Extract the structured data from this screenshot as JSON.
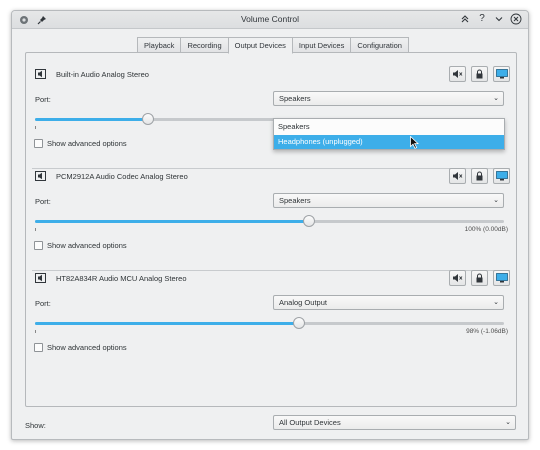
{
  "window": {
    "title": "Volume Control"
  },
  "tabs": [
    {
      "label": "Playback"
    },
    {
      "label": "Recording"
    },
    {
      "label": "Output Devices",
      "active": true
    },
    {
      "label": "Input Devices"
    },
    {
      "label": "Configuration"
    }
  ],
  "port_label": "Port:",
  "advanced_label": "Show advanced options",
  "devices": [
    {
      "name": "Built-in Audio Analog Stereo",
      "port": "Speakers",
      "volume_text": "",
      "volume_fraction": 0.24
    },
    {
      "name": "PCM2912A Audio Codec Analog Stereo",
      "port": "Speakers",
      "volume_text": "100% (0.00dB)",
      "volume_fraction": 0.585
    },
    {
      "name": "HT82A834R Audio MCU Analog Stereo",
      "port": "Analog Output",
      "volume_text": "98% (-1.06dB)",
      "volume_fraction": 0.562
    }
  ],
  "port_dropdown": {
    "options": [
      "Speakers",
      "Headphones (unplugged)"
    ],
    "highlighted": 1
  },
  "footer": {
    "show_label": "Show:",
    "show_value": "All Output Devices"
  },
  "colors": {
    "accent": "#3daee9",
    "window_bg": "#eff0f1"
  }
}
